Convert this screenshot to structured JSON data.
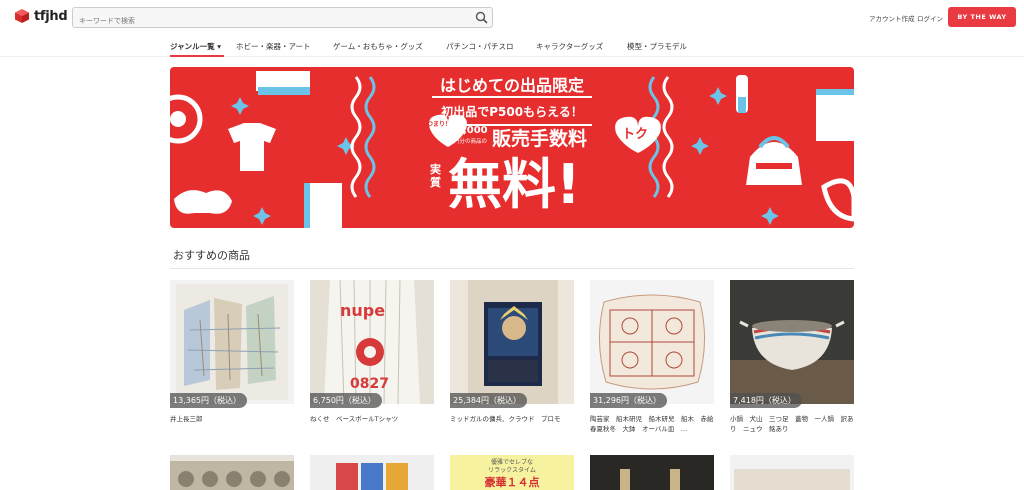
{
  "header": {
    "logo_text": "tfjhd",
    "search_placeholder": "キーワードで検索",
    "account_create": "アカウント作成",
    "login": "ログイン",
    "cta": "BY THE WAY"
  },
  "categories": [
    {
      "label": "ジャンル一覧 ▾",
      "active": true
    },
    {
      "label": "ホビー・楽器・アート"
    },
    {
      "label": "ゲーム・おもちゃ・グッズ"
    },
    {
      "label": "パチンコ・パチスロ"
    },
    {
      "label": "キャラクターグッズ"
    },
    {
      "label": "模型・プラモデル"
    }
  ],
  "banner": {
    "line1": "はじめての出品限定",
    "line2": "初出品でP500もらえる！",
    "bubble": "つまり！",
    "line3_small": "5,000",
    "line3_sub": "円分の商品の",
    "line3_big": "販売手数料",
    "jissitsu": "実質",
    "muryo": "無料!",
    "toku": "トク"
  },
  "section_title": "おすすめの商品",
  "products": [
    {
      "price": "13,365円（税込）",
      "name": "井上長三郎"
    },
    {
      "price": "6,750円（税込）",
      "name": "ねくせ　ベースボールTシャツ"
    },
    {
      "price": "25,384円（税込）",
      "name": "ミッドガルの傭兵、クラウド　プロモ"
    },
    {
      "price": "31,296円（税込）",
      "name": "陶芸家　船木研児　船木研兒　船木　赤絵　春夏秋冬　大鉢　オーバル皿　..."
    },
    {
      "price": "7,418円（税込）",
      "name": "小鍋　犬山　三つ足　蓋物　一人鍋　訳あり　ニュウ　銘あり"
    }
  ],
  "row2_labels": [
    "優雅でセレブな",
    "リラックスタイム",
    "豪華１４点"
  ],
  "colors": {
    "accent": "#e83a40",
    "banner_red": "#e62e2e"
  }
}
